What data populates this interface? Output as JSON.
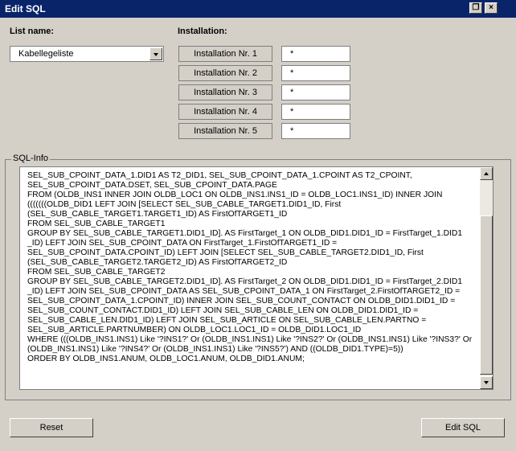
{
  "window": {
    "title": "Edit SQL"
  },
  "list": {
    "label": "List name:",
    "selected": "Kabellegeliste"
  },
  "installation": {
    "label": "Installation:",
    "rows": [
      {
        "label": "Installation Nr. 1",
        "value": "*"
      },
      {
        "label": "Installation Nr. 2",
        "value": "*"
      },
      {
        "label": "Installation Nr. 3",
        "value": "*"
      },
      {
        "label": "Installation Nr. 4",
        "value": "*"
      },
      {
        "label": "Installation Nr. 5",
        "value": "*"
      }
    ]
  },
  "sql_info": {
    "label": "SQL-Info",
    "text": "SEL_SUB_CPOINT_DATA_1.DID1 AS T2_DID1, SEL_SUB_CPOINT_DATA_1.CPOINT AS T2_CPOINT,\nSEL_SUB_CPOINT_DATA.DSET, SEL_SUB_CPOINT_DATA.PAGE\nFROM (OLDB_INS1 INNER JOIN OLDB_LOC1 ON OLDB_INS1.INS1_ID = OLDB_LOC1.INS1_ID) INNER JOIN\n(((((((OLDB_DID1 LEFT JOIN [SELECT SEL_SUB_CABLE_TARGET1.DID1_ID, First\n(SEL_SUB_CABLE_TARGET1.TARGET1_ID) AS FirstOfTARGET1_ID\nFROM SEL_SUB_CABLE_TARGET1\nGROUP BY SEL_SUB_CABLE_TARGET1.DID1_ID]. AS FirstTarget_1 ON OLDB_DID1.DID1_ID = FirstTarget_1.DID1\n_ID) LEFT JOIN SEL_SUB_CPOINT_DATA ON FirstTarget_1.FirstOfTARGET1_ID =\nSEL_SUB_CPOINT_DATA.CPOINT_ID) LEFT JOIN [SELECT SEL_SUB_CABLE_TARGET2.DID1_ID, First\n(SEL_SUB_CABLE_TARGET2.TARGET2_ID) AS FirstOfTARGET2_ID\nFROM SEL_SUB_CABLE_TARGET2\nGROUP BY SEL_SUB_CABLE_TARGET2.DID1_ID]. AS FirstTarget_2 ON OLDB_DID1.DID1_ID = FirstTarget_2.DID1\n_ID) LEFT JOIN SEL_SUB_CPOINT_DATA AS SEL_SUB_CPOINT_DATA_1 ON FirstTarget_2.FirstOfTARGET2_ID =\nSEL_SUB_CPOINT_DATA_1.CPOINT_ID) INNER JOIN SEL_SUB_COUNT_CONTACT ON OLDB_DID1.DID1_ID =\nSEL_SUB_COUNT_CONTACT.DID1_ID) LEFT JOIN SEL_SUB_CABLE_LEN ON OLDB_DID1.DID1_ID =\nSEL_SUB_CABLE_LEN.DID1_ID) LEFT JOIN SEL_SUB_ARTICLE ON SEL_SUB_CABLE_LEN.PARTNO =\nSEL_SUB_ARTICLE.PARTNUMBER) ON OLDB_LOC1.LOC1_ID = OLDB_DID1.LOC1_ID\nWHERE (((OLDB_INS1.INS1) Like '?INS1?' Or (OLDB_INS1.INS1) Like '?INS2?' Or (OLDB_INS1.INS1) Like '?INS3?' Or\n(OLDB_INS1.INS1) Like '?INS4?' Or (OLDB_INS1.INS1) Like '?INS5?') AND ((OLDB_DID1.TYPE)=5))\nORDER BY OLDB_INS1.ANUM, OLDB_LOC1.ANUM, OLDB_DID1.ANUM;"
  },
  "buttons": {
    "reset": "Reset",
    "edit_sql": "Edit SQL"
  },
  "icons": {
    "restore": "restore-window-icon",
    "close": "close-icon"
  },
  "colors": {
    "titlebar": "#0a246a",
    "face": "#d4d0c8"
  }
}
